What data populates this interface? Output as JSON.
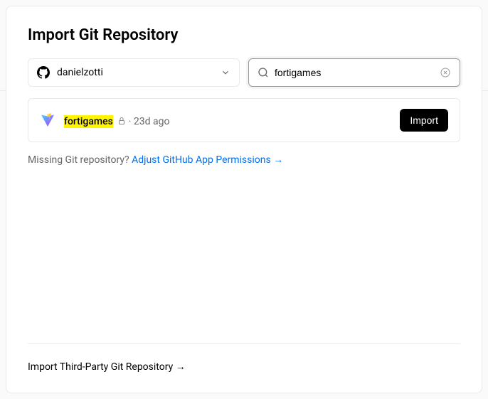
{
  "title": "Import Git Repository",
  "account": {
    "name": "danielzotti"
  },
  "search": {
    "value": "fortigames"
  },
  "repo": {
    "name": "fortigames",
    "updated": "23d ago",
    "importLabel": "Import"
  },
  "missing": {
    "prefix": "Missing Git repository? ",
    "linkText": "Adjust GitHub App Permissions →"
  },
  "thirdParty": {
    "label": "Import Third-Party Git Repository →"
  }
}
